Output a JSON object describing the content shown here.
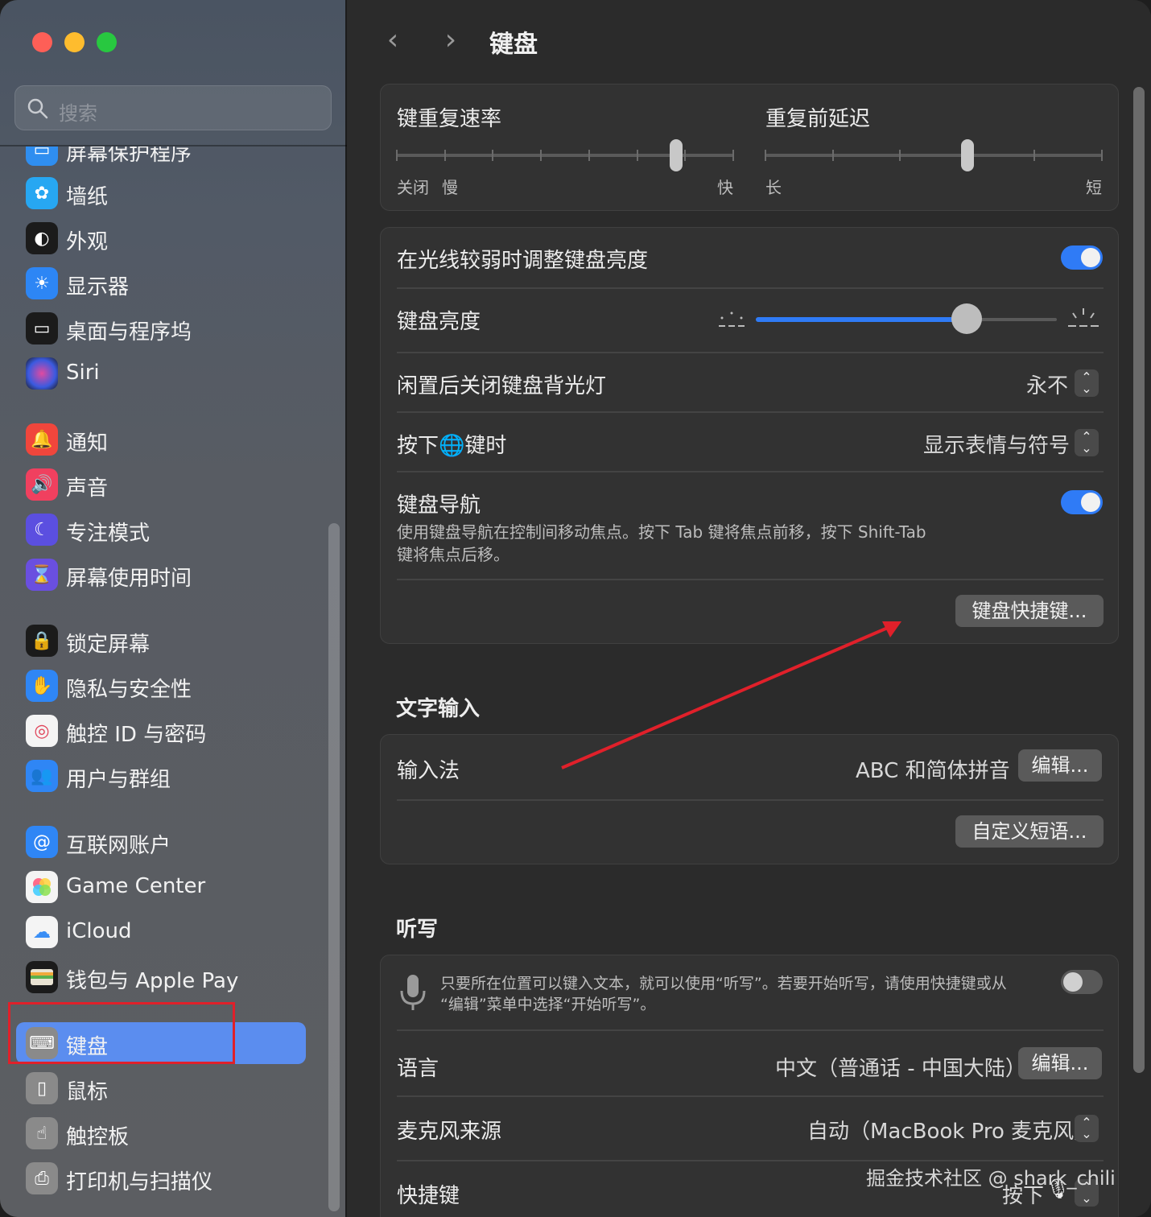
{
  "window": {
    "traffic_lights": [
      "close",
      "minimize",
      "zoom"
    ]
  },
  "sidebar": {
    "search_placeholder": "搜索",
    "items": [
      {
        "label": "屏幕保护程序",
        "icon": "screensaver-icon",
        "color": "#2f8ef0"
      },
      {
        "label": "墙纸",
        "icon": "wallpaper-icon",
        "color": "#27a7f2"
      },
      {
        "label": "外观",
        "icon": "appearance-icon",
        "color": "#1b1b1b"
      },
      {
        "label": "显示器",
        "icon": "display-icon",
        "color": "#2d86f5"
      },
      {
        "label": "桌面与程序坞",
        "icon": "desktop-dock-icon",
        "color": "#1b1b1b"
      },
      {
        "label": "Siri",
        "icon": "siri-icon",
        "color": "#5a3fd0"
      },
      {
        "label": "通知",
        "icon": "notification-icon",
        "color": "#f0463c"
      },
      {
        "label": "声音",
        "icon": "sound-icon",
        "color": "#f0405f"
      },
      {
        "label": "专注模式",
        "icon": "focus-icon",
        "color": "#5b4fe0"
      },
      {
        "label": "屏幕使用时间",
        "icon": "screen-time-icon",
        "color": "#6a4fe0"
      },
      {
        "label": "锁定屏幕",
        "icon": "lock-screen-icon",
        "color": "#1b1b1b"
      },
      {
        "label": "隐私与安全性",
        "icon": "privacy-hand-icon",
        "color": "#2f86f5"
      },
      {
        "label": "触控 ID 与密码",
        "icon": "fingerprint-icon",
        "color": "#f4f4f4"
      },
      {
        "label": "用户与群组",
        "icon": "users-icon",
        "color": "#2f86f5"
      },
      {
        "label": "互联网账户",
        "icon": "at-icon",
        "color": "#2f86f5"
      },
      {
        "label": "Game Center",
        "icon": "game-center-icon",
        "color": "#f4f4f4"
      },
      {
        "label": "iCloud",
        "icon": "icloud-icon",
        "color": "#f4f4f4"
      },
      {
        "label": "钱包与 Apple Pay",
        "icon": "wallet-icon",
        "color": "#1b1b1b"
      },
      {
        "label": "键盘",
        "icon": "keyboard-icon",
        "color": "#8a8a8a",
        "selected": true
      },
      {
        "label": "鼠标",
        "icon": "mouse-icon",
        "color": "#8a8a8a"
      },
      {
        "label": "触控板",
        "icon": "trackpad-icon",
        "color": "#8a8a8a"
      },
      {
        "label": "打印机与扫描仪",
        "icon": "printer-icon",
        "color": "#8a8a8a"
      }
    ],
    "selected_color": "#5b8def",
    "highlight_box_color": "#e0202a"
  },
  "main": {
    "title": "键盘",
    "repeat": {
      "rate_label": "键重复速率",
      "rate_ticks": [
        "关闭",
        "慢",
        "快"
      ],
      "rate_level": 0.83,
      "delay_label": "重复前延迟",
      "delay_ticks": [
        "长",
        "短"
      ],
      "delay_level": 0.6
    },
    "backlight": {
      "auto_label": "在光线较弱时调整键盘亮度",
      "auto_on": true,
      "brightness_label": "键盘亮度",
      "brightness_level": 0.7,
      "idle_label": "闲置后关闭键盘背光灯",
      "idle_value": "永不",
      "globe_label_pre": "按下",
      "globe_label_post": "键时",
      "globe_value": "显示表情与符号",
      "nav_label": "键盘导航",
      "nav_desc_1": "使用键盘导航在控制间移动焦点。按下 Tab 键将焦点前移，按下 Shift-Tab",
      "nav_desc_2": "键将焦点后移。",
      "nav_on": true,
      "shortcuts_button": "键盘快捷键..."
    },
    "text_input": {
      "section": "文字输入",
      "input_label": "输入法",
      "input_value": "ABC 和简体拼音",
      "edit_button": "编辑...",
      "replace_button": "自定义短语..."
    },
    "dictation": {
      "section": "听写",
      "desc_1": "只要所在位置可以键入文本，就可以使用“听写”。若要开始听写，请使用快捷键或从",
      "desc_2": "“编辑”菜单中选择“开始听写”。",
      "dictation_on": false,
      "language_label": "语言",
      "language_value": "中文（普通话 - 中国大陆）",
      "language_edit": "编辑...",
      "mic_label": "麦克风来源",
      "mic_value": "自动（MacBook Pro 麦克风）",
      "shortcut_label": "快捷键",
      "shortcut_value": "按下"
    },
    "accent_color": "#2f7bf6",
    "arrow_color": "#e0202a"
  },
  "watermark": "掘金技术社区 @ shark_chili"
}
